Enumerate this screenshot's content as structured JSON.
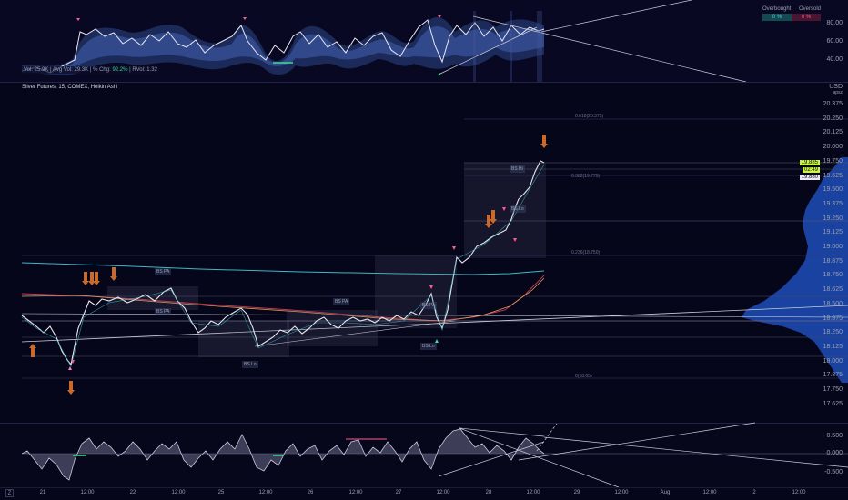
{
  "top_pane": {
    "legend": "",
    "stats": {
      "vol": "Vol: 25.9K",
      "avg_vol": "Avg Vol: 29.3K",
      "pct_chg_label": "% Chg:",
      "pct_chg": "92.2%",
      "rvol": "RVol: 1.32"
    },
    "overbought_label": "Overbought",
    "oversold_label": "Oversold",
    "overbought_value": "0 %",
    "oversold_value": "0 %",
    "axis": [
      "80.00",
      "60.00",
      "40.00"
    ]
  },
  "main_pane": {
    "legend": "Silver Futures, 15, COMEX, Heikin Ashi",
    "currency": "USD",
    "currency_sub": "apsz",
    "axis": [
      "20.375",
      "20.250",
      "20.125",
      "20.000",
      "19.750",
      "19.625",
      "19.500",
      "19.375",
      "19.250",
      "19.125",
      "19.000",
      "18.875",
      "18.750",
      "18.625",
      "18.500",
      "18.375",
      "18.250",
      "18.125",
      "18.000",
      "17.875",
      "17.750",
      "17.625"
    ],
    "price_tags": {
      "last": "19.885",
      "countdown": "02:49",
      "prev": "19.880"
    },
    "fib_labels": [
      "0.618(20.375)",
      "0.382(19.775)",
      "0.236(18.750)",
      "0(18.05)"
    ],
    "box_labels": [
      "BS PA",
      "BS PA",
      "BS PA",
      "BS PA",
      "BS Lo",
      "BS Lo",
      "BS Lo",
      "BS Hi"
    ]
  },
  "bottom_pane": {
    "axis": [
      "0.500",
      "0.000",
      "-0.500"
    ]
  },
  "time_axis": {
    "labels": [
      "21",
      "12:00",
      "22",
      "12:00",
      "25",
      "12:00",
      "26",
      "12:00",
      "27",
      "12:00",
      "28",
      "12:00",
      "29",
      "12:00",
      "Aug",
      "12:00",
      "2",
      "12:00"
    ]
  },
  "colors": {
    "background": "#07071c",
    "band_fill": "#2b3f7a",
    "candle_up": "#3fb8c4",
    "candle_down": "#e8e8f0",
    "arrow": "#c96a2b",
    "signal_up": "#3ddc97",
    "signal_down": "#ff5c8a",
    "last_price": "#c8f542"
  },
  "left_toolbar_icon": "Z"
}
